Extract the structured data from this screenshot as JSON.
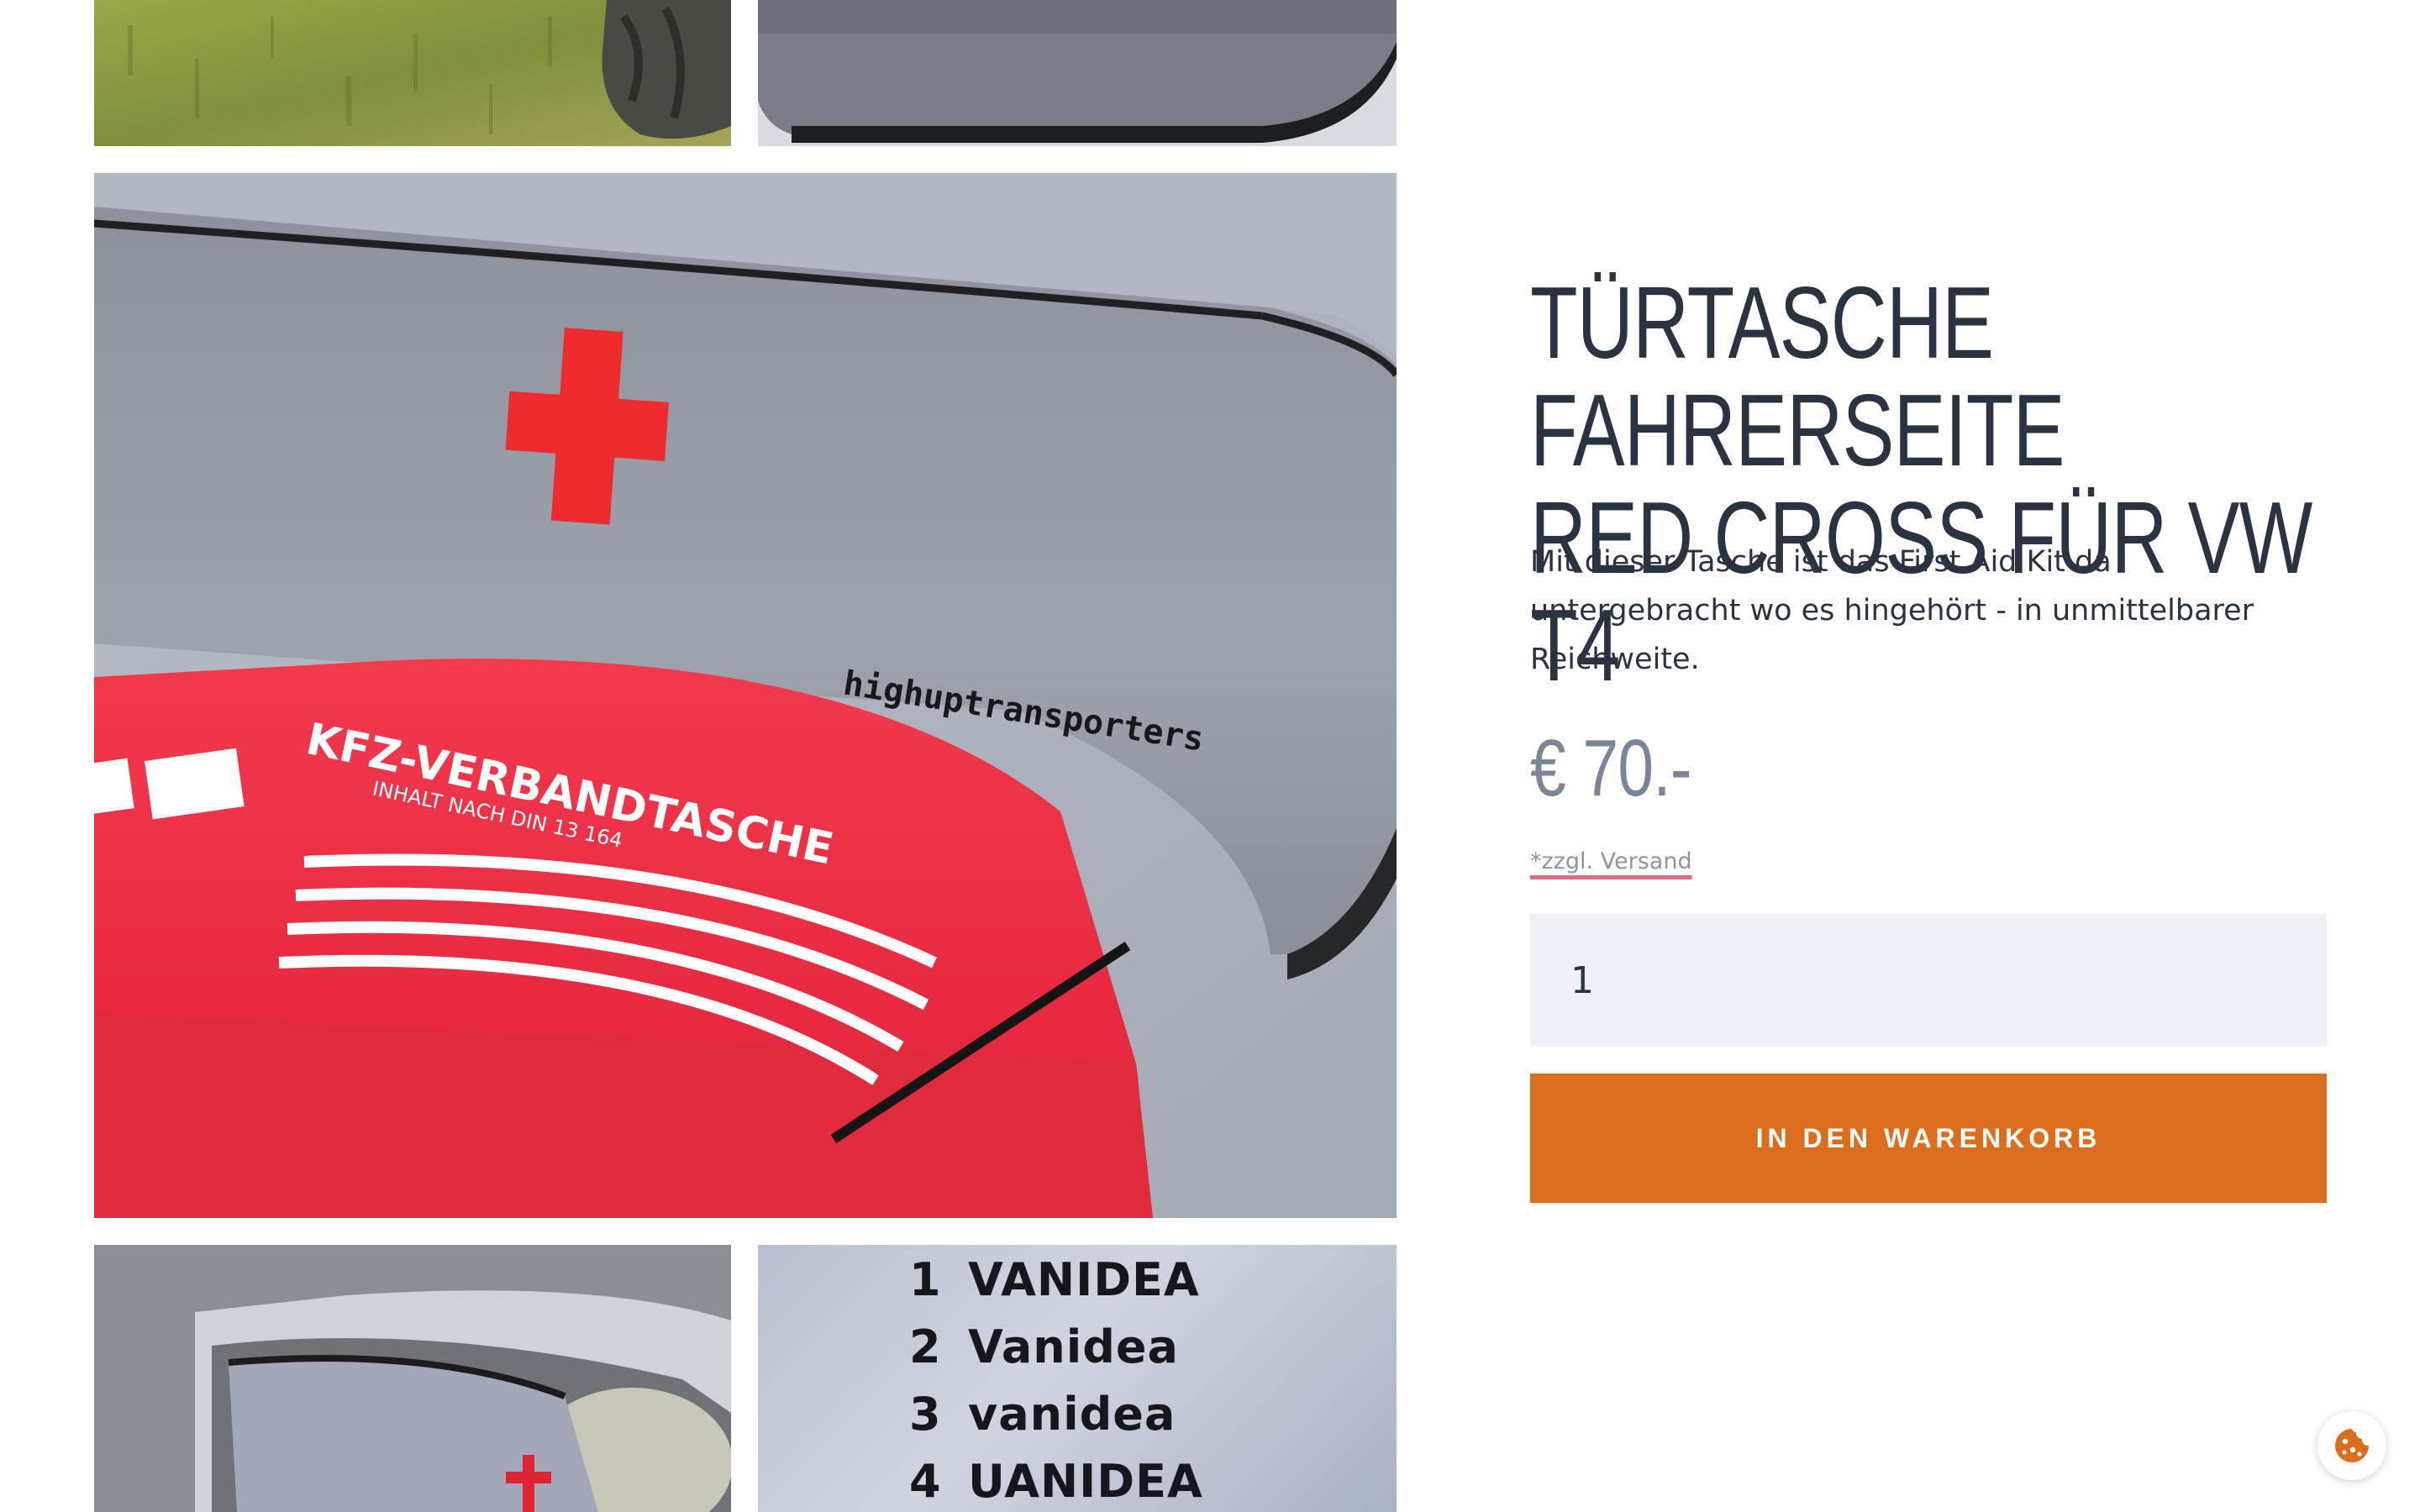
{
  "gallery": {
    "bottom_right_lines": [
      {
        "num": "1",
        "text": "VANIDEA"
      },
      {
        "num": "2",
        "text": "Vanidea"
      },
      {
        "num": "3",
        "text": "vanidea"
      },
      {
        "num": "4",
        "text": "UANIDEA"
      }
    ],
    "main_photo": {
      "kit_label": "KFZ-VERBANDTASCHE",
      "kit_sublabel": "INHALT NACH DIN 13 164",
      "bag_embroidery": "highuptransporters"
    }
  },
  "product": {
    "title_line1": "Türtasche Fahrerseite",
    "title_line2": "Red Cross für VW T4",
    "description": "Mit dieser Tasche ist das First Aid Kit da untergebracht wo es hingehört - in unmittelbarer Reichweite.",
    "price": "€ 70.-",
    "shipping_note": "*zzgl. Versand",
    "quantity": "1",
    "add_to_cart_label": "In den Warenkorb"
  },
  "colors": {
    "accent": "#dc6d1d",
    "heading": "#2a3342",
    "price": "#7a8597",
    "input_bg": "#eef2f6",
    "link_underline": "#e36a85"
  },
  "icons": {
    "cookie_button": "cookie-icon"
  }
}
